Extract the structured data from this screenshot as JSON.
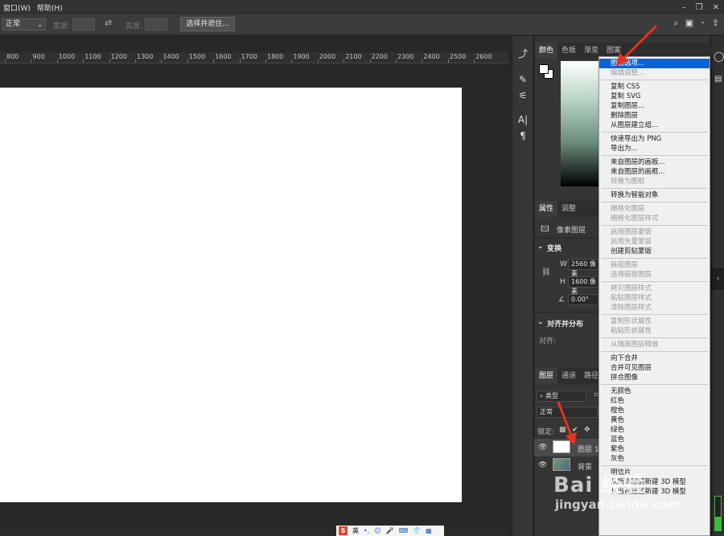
{
  "menubar": {
    "items": [
      "窗口(W)",
      "帮助(H)"
    ]
  },
  "options": {
    "mode": "正常",
    "width_label": "宽度:",
    "height_label": "高度:",
    "select_mask_button": "选择并遮住..."
  },
  "ruler": {
    "ticks": [
      "800",
      "900",
      "1000",
      "1100",
      "1200",
      "1300",
      "1400",
      "1500",
      "1600",
      "1700",
      "1800",
      "1900",
      "2000",
      "2100",
      "2200",
      "2300",
      "2400",
      "2500",
      "2600"
    ]
  },
  "panels": {
    "color_tabs": [
      "颜色",
      "色板",
      "渐变",
      "图案"
    ],
    "props_tabs": [
      "属性",
      "调整"
    ],
    "pixel_layer": "像素图层",
    "transform": "变换",
    "w_label": "W",
    "w_value": "2560 像素",
    "h_label": "H",
    "h_value": "1600 像素",
    "angle_value": "0.00°",
    "align_distribute": "对齐并分布",
    "align_label": "对齐:",
    "layers_tabs": [
      "图层",
      "通道",
      "路径"
    ],
    "kind_filter": "类型",
    "blend_mode": "正常",
    "lock_label": "锁定:",
    "layers": [
      {
        "name": "图层 1"
      },
      {
        "name": "背景"
      }
    ]
  },
  "context_menu": {
    "items": [
      {
        "label": "图层选项...",
        "state": "highlighted"
      },
      {
        "label": "编辑调整...",
        "state": "disabled"
      },
      {
        "label": "---"
      },
      {
        "label": "复制 CSS",
        "state": "enabled"
      },
      {
        "label": "复制 SVG",
        "state": "enabled"
      },
      {
        "label": "复制图层...",
        "state": "enabled"
      },
      {
        "label": "删除图层",
        "state": "enabled"
      },
      {
        "label": "从图层建立组...",
        "state": "enabled"
      },
      {
        "label": "---"
      },
      {
        "label": "快速导出为 PNG",
        "state": "enabled"
      },
      {
        "label": "导出为...",
        "state": "enabled"
      },
      {
        "label": "---"
      },
      {
        "label": "来自图层的画板...",
        "state": "enabled"
      },
      {
        "label": "来自图层的画框...",
        "state": "enabled"
      },
      {
        "label": "转换为图框",
        "state": "disabled"
      },
      {
        "label": "---"
      },
      {
        "label": "转换为智能对象",
        "state": "enabled"
      },
      {
        "label": "---"
      },
      {
        "label": "栅格化图层",
        "state": "disabled"
      },
      {
        "label": "栅格化图层样式",
        "state": "disabled"
      },
      {
        "label": "---"
      },
      {
        "label": "启用图层蒙版",
        "state": "disabled"
      },
      {
        "label": "启用矢量蒙版",
        "state": "disabled"
      },
      {
        "label": "创建剪贴蒙版",
        "state": "enabled"
      },
      {
        "label": "---"
      },
      {
        "label": "链接图层",
        "state": "disabled"
      },
      {
        "label": "选择链接图层",
        "state": "disabled"
      },
      {
        "label": "---"
      },
      {
        "label": "拷贝图层样式",
        "state": "disabled"
      },
      {
        "label": "粘贴图层样式",
        "state": "disabled"
      },
      {
        "label": "清除图层样式",
        "state": "disabled"
      },
      {
        "label": "---"
      },
      {
        "label": "复制形状属性",
        "state": "disabled"
      },
      {
        "label": "粘贴形状属性",
        "state": "disabled"
      },
      {
        "label": "---"
      },
      {
        "label": "从隔离图层释放",
        "state": "disabled"
      },
      {
        "label": "---"
      },
      {
        "label": "向下合并",
        "state": "enabled"
      },
      {
        "label": "合并可见图层",
        "state": "enabled"
      },
      {
        "label": "拼合图像",
        "state": "enabled"
      },
      {
        "label": "---"
      },
      {
        "label": "无颜色",
        "state": "enabled"
      },
      {
        "label": "红色",
        "state": "enabled"
      },
      {
        "label": "橙色",
        "state": "enabled"
      },
      {
        "label": "黄色",
        "state": "enabled"
      },
      {
        "label": "绿色",
        "state": "enabled"
      },
      {
        "label": "蓝色",
        "state": "enabled"
      },
      {
        "label": "紫色",
        "state": "enabled"
      },
      {
        "label": "灰色",
        "state": "enabled"
      },
      {
        "label": "---"
      },
      {
        "label": "明信片",
        "state": "enabled"
      },
      {
        "label": "从所选图层新建 3D 模型",
        "state": "enabled"
      },
      {
        "label": "从当前选区新建 3D 模型",
        "state": "enabled"
      }
    ]
  },
  "ime": {
    "brand": "S",
    "lang": "英"
  },
  "watermark": {
    "logo": "Bai 经验",
    "url": "jingyan.baidu.com"
  },
  "colors": {
    "highlight": "#0a64d7",
    "annotation_arrow": "#e8321e"
  }
}
